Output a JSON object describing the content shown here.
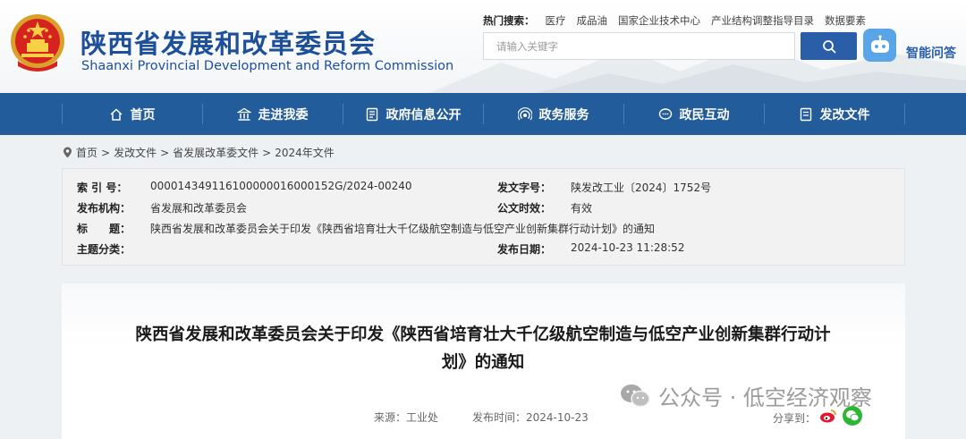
{
  "header": {
    "title_cn": "陕西省发展和改革委员会",
    "title_en": "Shaanxi Provincial Development and Reform Commission",
    "hot_label": "热门搜索：",
    "hot_items": [
      "医疗",
      "成品油",
      "国家企业技术中心",
      "产业结构调整指导目录",
      "数据要素"
    ],
    "search_placeholder": "请输入关键字",
    "assistant_label": "智能问答"
  },
  "nav": {
    "items": [
      {
        "label": "首页",
        "icon": "home-icon"
      },
      {
        "label": "走进我委",
        "icon": "building-icon"
      },
      {
        "label": "政府信息公开",
        "icon": "document-icon"
      },
      {
        "label": "政务服务",
        "icon": "service-icon"
      },
      {
        "label": "政民互动",
        "icon": "chat-icon"
      },
      {
        "label": "发改文件",
        "icon": "file-icon"
      }
    ]
  },
  "breadcrumb": {
    "items": [
      "首页",
      "发改文件",
      "省发展改革委文件",
      "2024年文件"
    ],
    "separator": ">"
  },
  "info": {
    "index_label": "索 引 号：",
    "index_value": "000014349116100000016000152G/2024-00240",
    "doc_no_label": "发文字号：",
    "doc_no_value": "陕发改工业〔2024〕1752号",
    "issuer_label": "发布机构：",
    "issuer_value": "省发展和改革委员会",
    "validity_label": "公文时效：",
    "validity_value": "有效",
    "title_label": "标　　题：",
    "title_value": "陕西省发展和改革委员会关于印发《陕西省培育壮大千亿级航空制造与低空产业创新集群行动计划》的通知",
    "category_label": "主题分类：",
    "category_value": "",
    "date_label": "发布日期：",
    "date_value": "2024-10-23 11:28:52"
  },
  "article": {
    "title_line1": "陕西省发展和改革委员会关于印发《陕西省培育壮大千亿级航空制造与低空产业创新集群行动计",
    "title_line2": "划》的通知",
    "source": "来源：工业处",
    "publish_time": "发布时间：2024-10-23",
    "share_label": "分享到：",
    "share_icons": [
      "weibo-icon",
      "wechat-icon"
    ]
  },
  "watermark": {
    "text": "公众号 · 低空经济观察"
  },
  "colors": {
    "brand": "#1d4f9a",
    "nav_bg": "#235c9b",
    "search_btn": "#2a5ea8",
    "assistant_btn": "#5aa4e8"
  }
}
